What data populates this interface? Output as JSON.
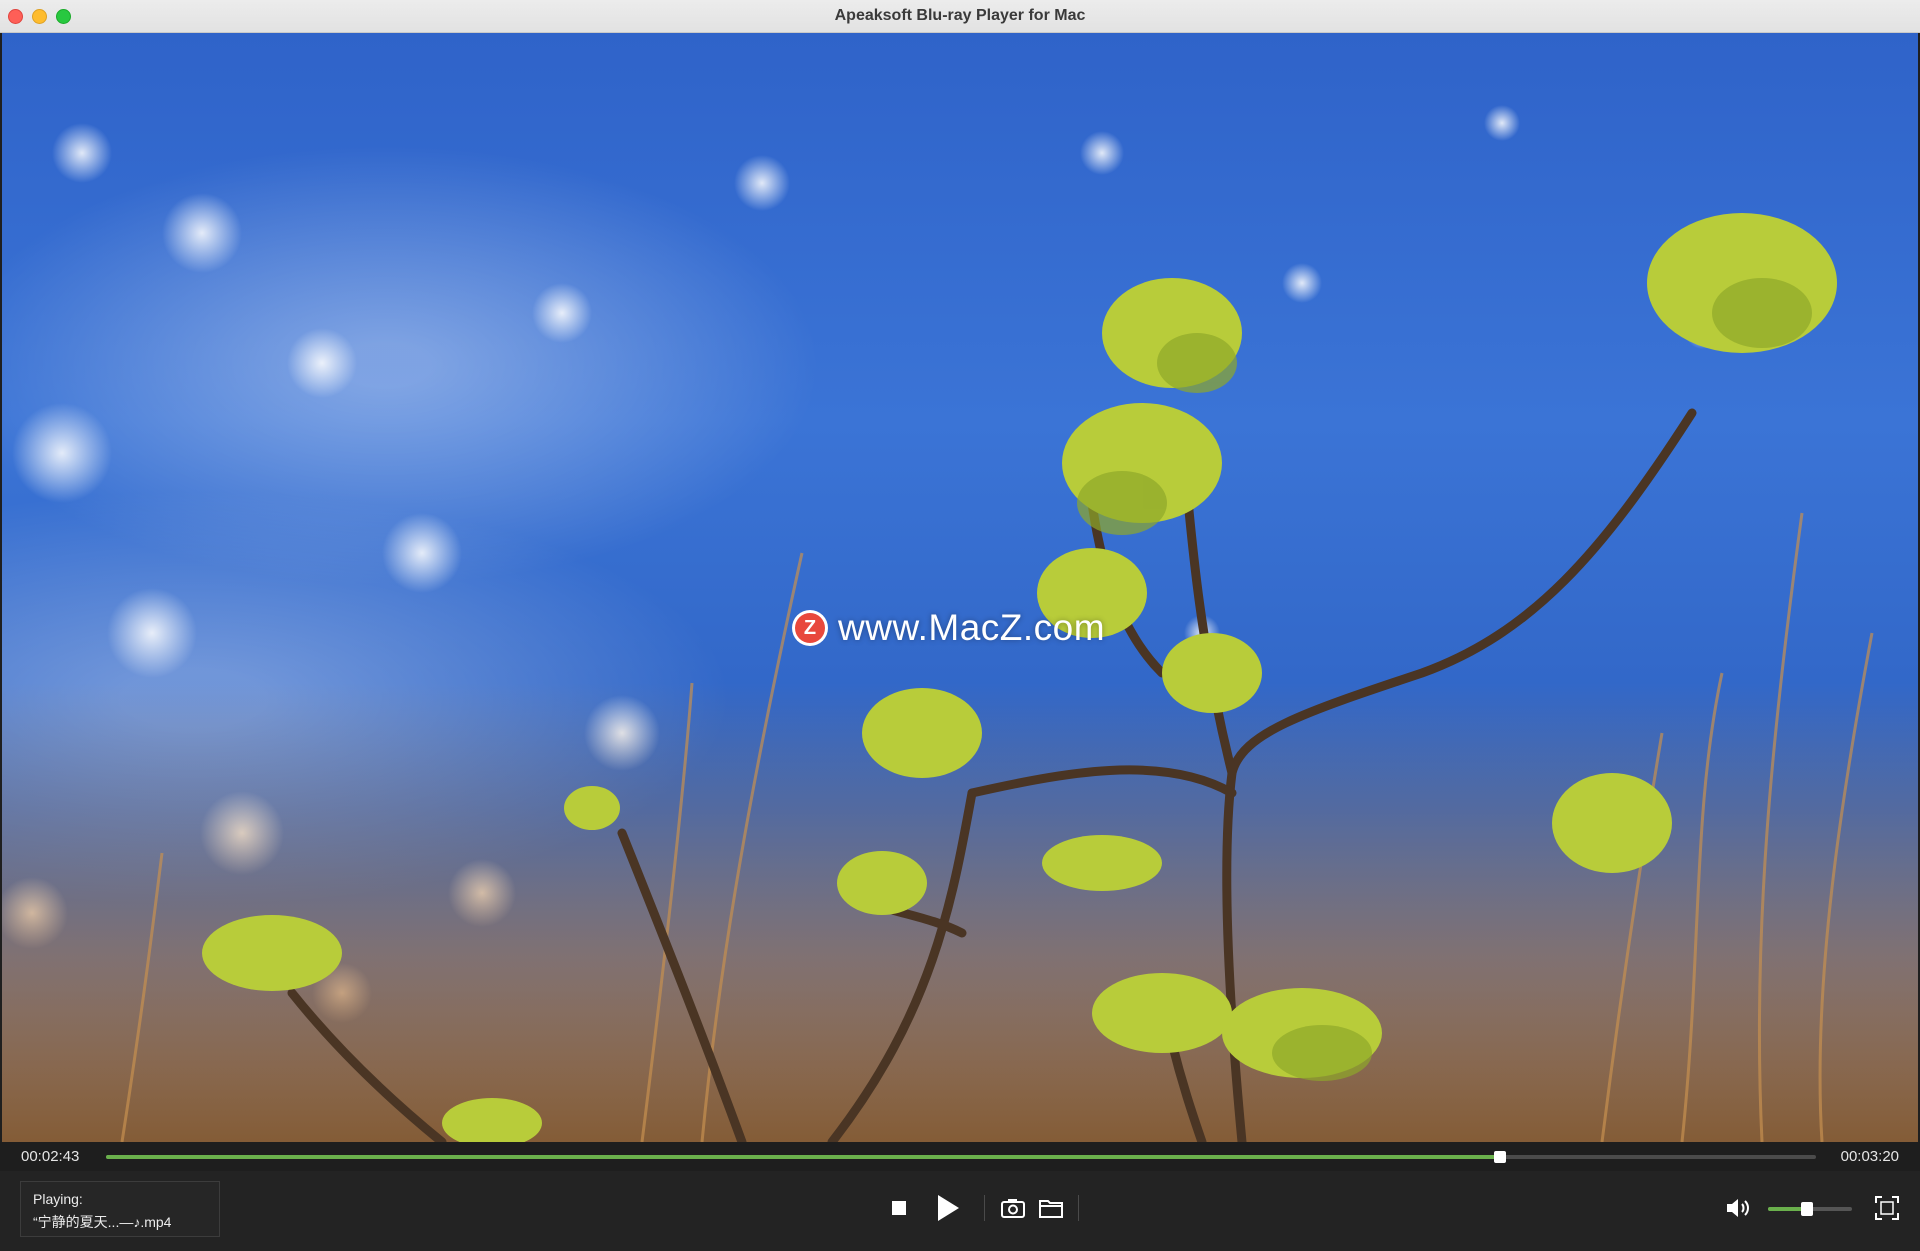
{
  "window": {
    "title": "Apeaksoft Blu-ray Player for Mac"
  },
  "video": {
    "watermark_logo": "Z",
    "watermark_text": "www.MacZ.com"
  },
  "progress": {
    "current_time": "00:02:43",
    "total_time": "00:03:20",
    "fraction": 0.815,
    "fill_color": "#6ab04c"
  },
  "now_playing": {
    "label": "Playing:",
    "file": "“宁静的夏天...—♪.mp4"
  },
  "volume": {
    "level": 0.47
  },
  "icons": {
    "stop": "stop-icon",
    "play": "play-icon",
    "snapshot": "camera-icon",
    "open": "folder-icon",
    "volume": "speaker-icon",
    "fullscreen": "fullscreen-icon"
  }
}
